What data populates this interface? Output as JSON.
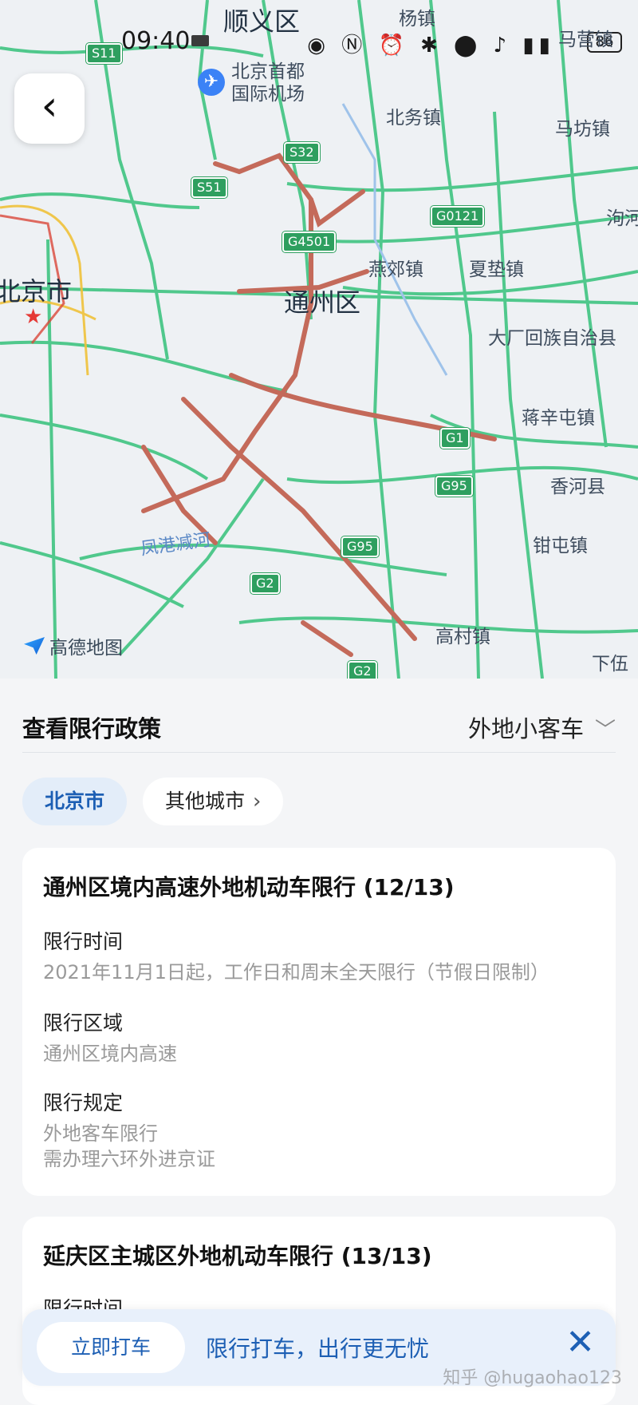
{
  "status_bar": {
    "time": "09:40",
    "battery": "86"
  },
  "map": {
    "labels": {
      "shunyi": "顺义区",
      "yangzhen": "杨镇",
      "airport": "北京首都\n国际机场",
      "beiwu": "北务镇",
      "mafang": "马坊镇",
      "yanjiao": "燕郊镇",
      "xiadian": "夏垫镇",
      "tongzhou": "通州区",
      "beijing": "北京市",
      "dachang": "大厂回族自治县",
      "jiangxintun": "蒋辛屯镇",
      "xianghe": "香河县",
      "qiantun": "钳屯镇",
      "gaocun": "高村镇",
      "xiawu": "下伍",
      "fenggang": "凤港减河",
      "paohe": "泃河",
      "top_right": "马营镇"
    },
    "shields": [
      "S11",
      "S32",
      "S51",
      "G4501",
      "G0121",
      "G1",
      "G95",
      "G95",
      "G2",
      "G2"
    ],
    "logo": "高德地图"
  },
  "policy": {
    "title": "查看限行政策",
    "vehicle_type": "外地小客车",
    "tabs": [
      {
        "label": "北京市",
        "active": true
      },
      {
        "label": "其他城市",
        "active": false
      }
    ],
    "cards": [
      {
        "title": "通州区境内高速外地机动车限行 (12/13)",
        "time_label": "限行时间",
        "time_value": "2021年11月1日起，工作日和周末全天限行（节假日限制）",
        "area_label": "限行区域",
        "area_value": "通州区境内高速",
        "rule_label": "限行规定",
        "rule_value_1": "外地客车限行",
        "rule_value_2": "需办理六环外进京证"
      },
      {
        "title": "延庆区主城区外地机动车限行 (13/13)",
        "time_label": "限行时间"
      }
    ]
  },
  "banner": {
    "cta": "立即打车",
    "message": "限行打车，出行更无忧"
  },
  "watermark": "知乎 @hugaohao123"
}
